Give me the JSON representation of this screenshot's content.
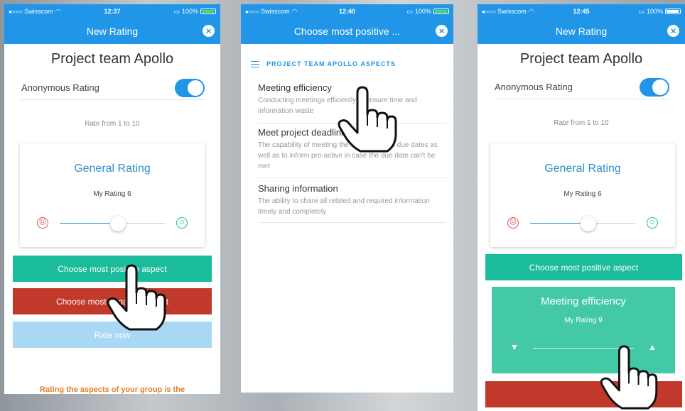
{
  "screens": [
    {
      "status": {
        "carrier": "Swisscom",
        "time": "12:37",
        "battery": "100%",
        "signal_dots": "●○○○○"
      },
      "nav_title": "New Rating",
      "project_title": "Project team Apollo",
      "anonymous_label": "Anonymous Rating",
      "anonymous_on": true,
      "hint": "Rate from 1 to 10",
      "card_title": "General Rating",
      "rating_label": "My Rating 6",
      "rating_value": 6,
      "rating_max": 10,
      "btn_positive": "Choose most positive aspect",
      "btn_negative": "Choose most negative aspect",
      "btn_rate": "Rate now",
      "footer": "Rating the aspects of your group is the"
    },
    {
      "status": {
        "carrier": "Swisscom",
        "time": "12:40",
        "battery": "100%",
        "signal_dots": "●○○○○"
      },
      "nav_title": "Choose most positive ...",
      "section_head": "PROJECT TEAM APOLLO ASPECTS",
      "aspects": [
        {
          "title": "Meeting efficiency",
          "desc": "Conducting meetings efficiently to ensure time and information waste"
        },
        {
          "title": "Meet project deadlines",
          "desc": "The capability of meeting the deadlines and due dates as well as to inform pro-active in case the due date can't be met"
        },
        {
          "title": "Sharing information",
          "desc": "The ability to share all related and required information timely and completely"
        }
      ]
    },
    {
      "status": {
        "carrier": "Swisscom",
        "time": "12:45",
        "battery": "100%",
        "signal_dots": "●○○○○"
      },
      "nav_title": "New Rating",
      "project_title": "Project team Apollo",
      "anonymous_label": "Anonymous Rating",
      "anonymous_on": true,
      "hint": "Rate from 1 to 10",
      "card_title": "General Rating",
      "rating_label": "My Rating 6",
      "rating_value": 6,
      "rating_max": 10,
      "btn_positive": "Choose most positive aspect",
      "aspect_card_title": "Meeting efficiency",
      "aspect_rating_label": "My Rating 9",
      "aspect_rating_value": 9
    }
  ],
  "colors": {
    "primary": "#2196e8",
    "positive": "#1abc9c",
    "negative": "#c0392b",
    "rate_disabled": "#a9d8f5",
    "aspect_card": "#44c9a6",
    "footer_text": "#e67e22"
  },
  "icons": {
    "close": "close-icon",
    "sad_face": "sad-face-icon",
    "happy_face": "happy-face-icon",
    "list": "list-icon",
    "thumbs_down": "thumbs-down-icon",
    "thumbs_up": "thumbs-up-icon",
    "pointer": "hand-pointer-icon"
  }
}
